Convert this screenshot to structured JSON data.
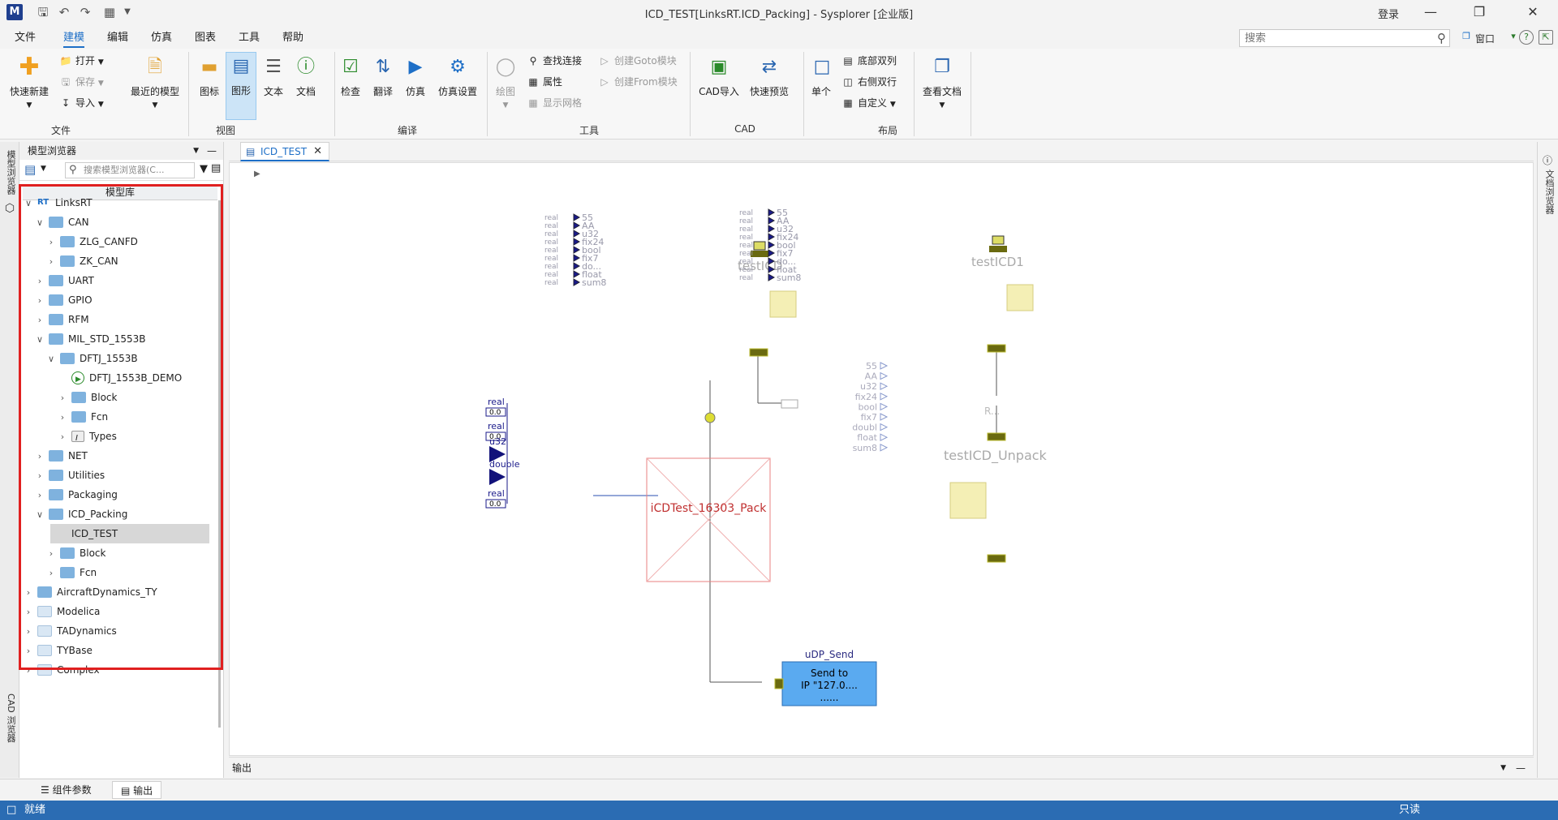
{
  "window": {
    "title": "ICD_TEST[LinksRT.ICD_Packing] - Sysplorer [企业版]",
    "login": "登录"
  },
  "menu": {
    "tabs": [
      "文件",
      "建模",
      "编辑",
      "仿真",
      "图表",
      "工具",
      "帮助"
    ],
    "active": "建模"
  },
  "search": {
    "placeholder": "搜索"
  },
  "window_menu": "窗口",
  "ribbon": {
    "file": {
      "quick_new": "快速新建",
      "open": "打开",
      "save": "保存",
      "import": "导入",
      "label": "文件"
    },
    "recent": "最近的模型",
    "view": {
      "icon": "图标",
      "diagram": "图形",
      "text": "文本",
      "doc": "文档",
      "label": "视图"
    },
    "compile": {
      "check": "检查",
      "translate": "翻译",
      "simulate": "仿真",
      "sim_settings": "仿真设置",
      "label": "编译"
    },
    "tools": {
      "draw": "绘图",
      "find_conn": "查找连接",
      "props": "属性",
      "show_grid": "显示网格",
      "goto": "创建Goto模块",
      "from": "创建From模块",
      "label": "工具"
    },
    "cad": {
      "import": "CAD导入",
      "preview": "快速预览",
      "label": "CAD"
    },
    "layout": {
      "single": "单个",
      "bottom_dual": "底部双列",
      "right_dual": "右侧双行",
      "custom": "自定义",
      "label": "布局"
    },
    "view_doc": "查看文档"
  },
  "left_strip": {
    "model_browser": "模型浏览器",
    "cad_browser": "CAD 浏览器"
  },
  "browser": {
    "title": "模型浏览器",
    "search_placeholder": "搜索模型浏览器(C...",
    "tree_header": "模型库",
    "items": [
      {
        "label": "LinksRT",
        "level": 0,
        "chev": "v",
        "icon": "rt"
      },
      {
        "label": "CAN",
        "level": 1,
        "chev": "v",
        "icon": "folder"
      },
      {
        "label": "ZLG_CANFD",
        "level": 2,
        "chev": ">",
        "icon": "folder"
      },
      {
        "label": "ZK_CAN",
        "level": 2,
        "chev": ">",
        "icon": "folder"
      },
      {
        "label": "UART",
        "level": 1,
        "chev": ">",
        "icon": "folder"
      },
      {
        "label": "GPIO",
        "level": 1,
        "chev": ">",
        "icon": "folder"
      },
      {
        "label": "RFM",
        "level": 1,
        "chev": ">",
        "icon": "folder"
      },
      {
        "label": "MIL_STD_1553B",
        "level": 1,
        "chev": "v",
        "icon": "folder"
      },
      {
        "label": "DFTJ_1553B",
        "level": 2,
        "chev": "v",
        "icon": "folder"
      },
      {
        "label": "DFTJ_1553B_DEMO",
        "level": 3,
        "chev": "",
        "icon": "play"
      },
      {
        "label": "Block",
        "level": 3,
        "chev": ">",
        "icon": "folder"
      },
      {
        "label": "Fcn",
        "level": 3,
        "chev": ">",
        "icon": "folder"
      },
      {
        "label": "Types",
        "level": 3,
        "chev": ">",
        "icon": "types"
      },
      {
        "label": "NET",
        "level": 1,
        "chev": ">",
        "icon": "folder"
      },
      {
        "label": "Utilities",
        "level": 1,
        "chev": ">",
        "icon": "folder"
      },
      {
        "label": "Packaging",
        "level": 1,
        "chev": ">",
        "icon": "folder"
      },
      {
        "label": "ICD_Packing",
        "level": 1,
        "chev": "v",
        "icon": "folder"
      },
      {
        "label": "ICD_TEST",
        "level": 2,
        "chev": "",
        "icon": "none",
        "selected": true
      },
      {
        "label": "Block",
        "level": 2,
        "chev": ">",
        "icon": "folder"
      },
      {
        "label": "Fcn",
        "level": 2,
        "chev": ">",
        "icon": "folder"
      },
      {
        "label": "AircraftDynamics_TY",
        "level": 0,
        "chev": ">",
        "icon": "folder"
      },
      {
        "label": "Modelica",
        "level": 0,
        "chev": ">",
        "icon": "plain"
      },
      {
        "label": "TADynamics",
        "level": 0,
        "chev": ">",
        "icon": "plain"
      },
      {
        "label": "TYBase",
        "level": 0,
        "chev": ">",
        "icon": "plain"
      },
      {
        "label": "Complex",
        "level": 0,
        "chev": ">",
        "icon": "plain"
      }
    ]
  },
  "editor": {
    "tab": "ICD_TEST",
    "output_label": "输出"
  },
  "diagram": {
    "testICD": {
      "name": "testICD",
      "ports": [
        "55",
        "AA",
        "u32",
        "fix24",
        "bool",
        "fix7",
        "do...",
        "float",
        "sum8"
      ]
    },
    "testICD1": {
      "name": "testICD1",
      "ports": [
        "55",
        "AA",
        "u32",
        "fix24",
        "bool",
        "fix7",
        "do...",
        "float",
        "sum8"
      ]
    },
    "unpack": {
      "name": "testICD_Unpack",
      "ports": [
        "55",
        "AA",
        "u32",
        "fix24",
        "bool",
        "fix7",
        "doubl",
        "float",
        "sum8"
      ]
    },
    "pack": {
      "name": "iCDTest_16303_Pack",
      "inputs": [
        "real",
        "real",
        "u32",
        "double",
        "real"
      ],
      "values": [
        "0.0",
        "0.0",
        "0.0"
      ]
    },
    "udp": {
      "name": "uDP_Send",
      "line1": "Send to",
      "line2": "IP \"127.0....",
      "line3": "......"
    },
    "input_tag": "real",
    "value_tag": "0.0",
    "misc_label": "R..."
  },
  "right_strip": {
    "doc_browser": "文档浏览器"
  },
  "bottom_tabs": [
    "组件参数",
    "输出"
  ],
  "status": {
    "left": "就绪",
    "right": "只读"
  }
}
